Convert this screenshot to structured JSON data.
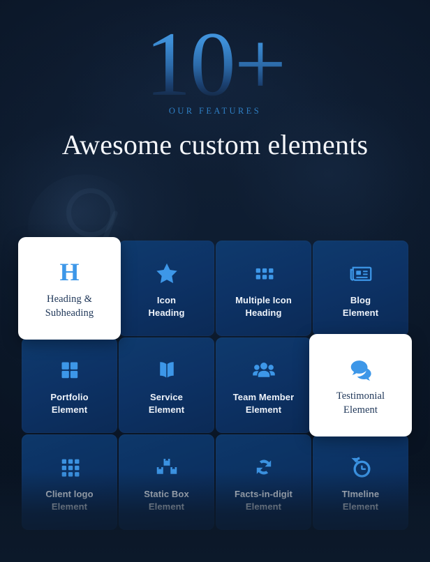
{
  "hero": {
    "big_number": "10+",
    "eyebrow": "OUR FEATURES",
    "headline": "Awesome custom elements"
  },
  "colors": {
    "background": "#0e1c30",
    "card_blue": "#0d3265",
    "icon_blue": "#3d97e8",
    "active_card_bg": "#ffffff",
    "active_label": "#1d3557",
    "eyebrow": "#2f7fc4"
  },
  "grid": {
    "cards": [
      {
        "label": "Heading &\nSubheading",
        "icon": "letter-h-icon",
        "active": true
      },
      {
        "label": "Icon\nHeading",
        "icon": "star-icon",
        "active": false
      },
      {
        "label": "Multiple Icon\nHeading",
        "icon": "multi-squares-icon",
        "active": false
      },
      {
        "label": "Blog\nElement",
        "icon": "newspaper-icon",
        "active": false
      },
      {
        "label": "Portfolio\nElement",
        "icon": "grid-2x2-icon",
        "active": false
      },
      {
        "label": "Service\nElement",
        "icon": "open-book-icon",
        "active": false
      },
      {
        "label": "Team Member\nElement",
        "icon": "people-group-icon",
        "active": false
      },
      {
        "label": "Testimonial\nElement",
        "icon": "chat-bubbles-icon",
        "active": true
      },
      {
        "label": "Client logo\nElement",
        "icon": "grid-3x3-icon",
        "active": false
      },
      {
        "label": "Static Box\nElement",
        "icon": "stacked-boxes-icon",
        "active": false
      },
      {
        "label": "Facts-in-digit\nElement",
        "icon": "sync-arrows-icon",
        "active": false
      },
      {
        "label": "TImeline\nElement",
        "icon": "clock-history-icon",
        "active": false
      }
    ]
  }
}
